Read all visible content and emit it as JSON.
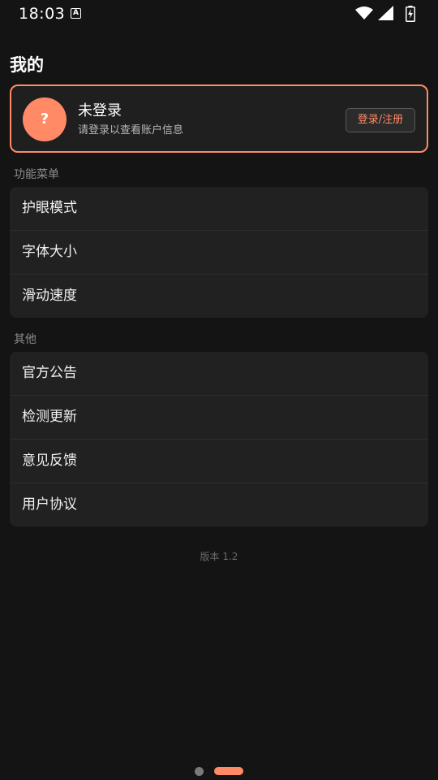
{
  "status_bar": {
    "time": "18:03",
    "notif_icon_letter": "A"
  },
  "page": {
    "title": "我的"
  },
  "profile": {
    "avatar_symbol": "?",
    "name": "未登录",
    "subtitle": "请登录以查看账户信息",
    "login_button": "登录/注册"
  },
  "sections": {
    "features": {
      "label": "功能菜单",
      "items": [
        "护眼模式",
        "字体大小",
        "滑动速度"
      ]
    },
    "other": {
      "label": "其他",
      "items": [
        "官方公告",
        "检测更新",
        "意见反馈",
        "用户协议"
      ]
    }
  },
  "version": "版本 1.2",
  "colors": {
    "accent": "#ff8a65",
    "background": "#141414",
    "card": "#212121"
  },
  "page_indicator": {
    "total": 2,
    "active": 2
  }
}
